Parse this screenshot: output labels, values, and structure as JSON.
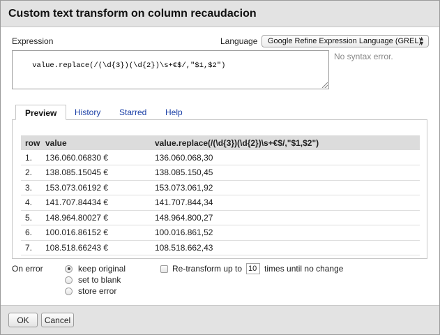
{
  "dialog": {
    "title": "Custom text transform on column recaudacion"
  },
  "expression": {
    "label": "Expression",
    "value": "value.replace(/(\\d{3})(\\d{2})\\s+€$/,\"$1,$2\")",
    "status": "No syntax error."
  },
  "language": {
    "label": "Language",
    "selected": "Google Refine Expression Language (GREL)"
  },
  "tabs": [
    {
      "label": "Preview",
      "active": true
    },
    {
      "label": "History",
      "active": false
    },
    {
      "label": "Starred",
      "active": false
    },
    {
      "label": "Help",
      "active": false
    }
  ],
  "table": {
    "headers": [
      "row",
      "value",
      "value.replace(/(\\d{3})(\\d{2})\\s+€$/,\"$1,$2\")"
    ],
    "rows": [
      [
        "1.",
        "136.060.06830 €",
        "136.060.068,30"
      ],
      [
        "2.",
        "138.085.15045 €",
        "138.085.150,45"
      ],
      [
        "3.",
        "153.073.06192 €",
        "153.073.061,92"
      ],
      [
        "4.",
        "141.707.84434 €",
        "141.707.844,34"
      ],
      [
        "5.",
        "148.964.80027 €",
        "148.964.800,27"
      ],
      [
        "6.",
        "100.016.86152 €",
        "100.016.861,52"
      ],
      [
        "7.",
        "108.518.66243 €",
        "108.518.662,43"
      ]
    ]
  },
  "on_error": {
    "label": "On error",
    "options": [
      {
        "label": "keep original",
        "checked": true
      },
      {
        "label": "set to blank",
        "checked": false
      },
      {
        "label": "store error",
        "checked": false
      }
    ]
  },
  "retransform": {
    "checked": false,
    "prefix": "Re-transform up to",
    "times": "10",
    "suffix": "times until no change"
  },
  "buttons": {
    "ok": "OK",
    "cancel": "Cancel"
  }
}
